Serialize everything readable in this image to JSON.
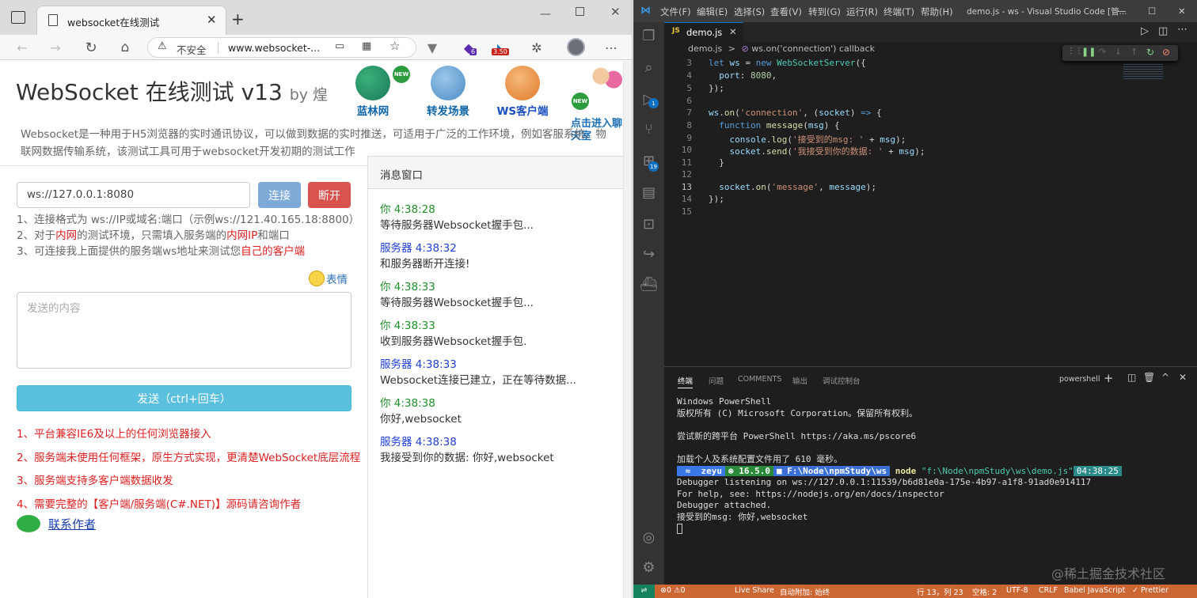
{
  "browser": {
    "tab_title": "websocket在线测试",
    "address_security": "不安全",
    "address_url": "www.websocket-...",
    "ext_badge_1": "6",
    "ext_badge_2": "3.50",
    "page": {
      "title": "WebSocket 在线测试 v13",
      "by": "by 煌",
      "nav": [
        "蓝林网",
        "转发场景",
        "WS客户端",
        "点击进入聊天室"
      ],
      "new_badge": "NEW",
      "description": "Websocket是一种用于H5浏览器的实时通讯协议，可以做到数据的实时推送，可适用于广泛的工作环境，例如客服系统、物联网数据传输系统，该测试工具可用于websocket开发初期的测试工作",
      "url_value": "ws://127.0.0.1:8080",
      "connect_label": "连接",
      "disconnect_label": "断开",
      "tip1": "1、连接格式为 ws://IP或域名:端口（示例ws://121.40.165.18:8800）",
      "tip2_a": "2、对于",
      "tip2_b": "内网",
      "tip2_c": "的测试环境，只需填入服务端的",
      "tip2_d": "内网IP",
      "tip2_e": "和端口",
      "tip3_a": "3、可连接我上面提供的服务端ws地址来测试您",
      "tip3_b": "自己的客户端",
      "emoji_label": "表情",
      "send_placeholder": "发送的内容",
      "send_label": "发送（ctrl+回车）",
      "notes": [
        "1、平台兼容IE6及以上的任何浏览器接入",
        "2、服务端未使用任何框架，原生方式实现，更清楚WebSocket底层流程",
        "3、服务端支持多客户端数据收发",
        "4、需要完整的【客户端/服务端(C#.NET)】源码请咨询作者"
      ],
      "contact_label": "联系作者",
      "msg_title": "消息窗口",
      "messages": [
        {
          "who": "你 4:38:28",
          "text": "等待服务器Websocket握手包..."
        },
        {
          "who": "服务器 4:38:32",
          "text": "和服务器断开连接!"
        },
        {
          "who": "你 4:38:33",
          "text": "等待服务器Websocket握手包..."
        },
        {
          "who": "你 4:38:33",
          "text": "收到服务器Websocket握手包."
        },
        {
          "who": "服务器 4:38:33",
          "text": "Websocket连接已建立，正在等待数据..."
        },
        {
          "who": "你 4:38:38",
          "text": "你好,websocket"
        },
        {
          "who": "服务器 4:38:38",
          "text": "我接受到你的数据: 你好,websocket"
        }
      ]
    }
  },
  "vscode": {
    "menu": [
      "文件(F)",
      "编辑(E)",
      "选择(S)",
      "查看(V)",
      "转到(G)",
      "运行(R)",
      "终端(T)",
      "帮助(H)"
    ],
    "window_title": "demo.js - ws - Visual Studio Code [管...",
    "tab": "demo.js",
    "breadcrumb_file": "demo.js",
    "breadcrumb_sep": ">",
    "breadcrumb_symbol": "ws.on('connection') callback",
    "badges": {
      "run": "1",
      "ext": "19"
    },
    "line_numbers": [
      "3",
      "4",
      "5",
      "6",
      "7",
      "8",
      "9",
      "10",
      "11",
      "12",
      "13",
      "14",
      "15"
    ],
    "panel_tabs": [
      "终端",
      "问题",
      "COMMENTS",
      "输出",
      "调试控制台"
    ],
    "panel_shell": "powershell",
    "terminal": [
      "Windows PowerShell",
      "版权所有 (C) Microsoft Corporation。保留所有权利。",
      "",
      "尝试新的跨平台 PowerShell https://aka.ms/pscore6",
      "",
      "加载个人及系统配置文件用了 610 毫秒。"
    ],
    "prompt": {
      "user": "zeyu",
      "node": "16.5.0",
      "path": "F:\\Node\\npmStudy\\ws",
      "cmd": "node",
      "arg": "\"f:\\Node\\npmStudy\\ws\\demo.js\"",
      "time": "04:38:25"
    },
    "terminal_after": [
      "Debugger listening on ws://127.0.0.1:11539/b6d81e0a-175e-4b97-a1f8-91ad0e914117",
      "For help, see: https://nodejs.org/en/docs/inspector",
      "Debugger attached.",
      "接受到的msg: 你好,websocket"
    ],
    "status": {
      "errors": "⊗0 ⚠0",
      "liveshare": "Live Share",
      "autoattach": "自动附加: 始终",
      "position": "行 13，列 23",
      "spaces": "空格: 2",
      "encoding": "UTF-8",
      "eol": "CRLF",
      "language": "Babel JavaScript",
      "prettier": "✓ Prettier"
    },
    "watermark": "@稀土掘金技术社区"
  },
  "colors": {
    "vscode_status": "#cc6633",
    "btn_connect": "#7fa9d6",
    "btn_disconnect": "#d9534f",
    "btn_send": "#5bc0de"
  }
}
